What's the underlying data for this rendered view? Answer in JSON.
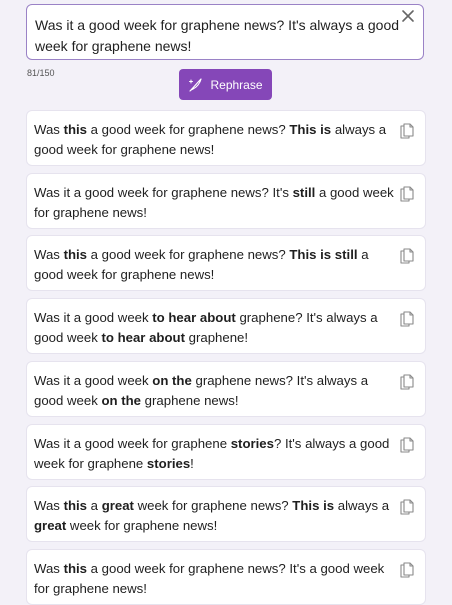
{
  "input": {
    "text": "Was it a good week for graphene news? It's always a good week for graphene news!",
    "char_count": "81/150"
  },
  "toolbar": {
    "rephrase_label": "Rephrase"
  },
  "colors": {
    "accent": "#8547b8",
    "input_border": "#9a82c6",
    "background": "#f3f1f8"
  },
  "icons": {
    "close": "close-icon",
    "rephrase": "quill-sparkle-icon",
    "copy": "copy-icon"
  },
  "results": [
    {
      "segments": [
        {
          "t": "Was ",
          "b": false
        },
        {
          "t": "this",
          "b": true
        },
        {
          "t": " a good week for graphene news? ",
          "b": false
        },
        {
          "t": "This is",
          "b": true
        },
        {
          "t": " always a good week for graphene news!",
          "b": false
        }
      ]
    },
    {
      "segments": [
        {
          "t": "Was it a good week for graphene news? It's ",
          "b": false
        },
        {
          "t": "still",
          "b": true
        },
        {
          "t": " a good week for graphene news!",
          "b": false
        }
      ]
    },
    {
      "segments": [
        {
          "t": "Was ",
          "b": false
        },
        {
          "t": "this",
          "b": true
        },
        {
          "t": " a good week for graphene news? ",
          "b": false
        },
        {
          "t": "This is still",
          "b": true
        },
        {
          "t": " a good week for graphene news!",
          "b": false
        }
      ]
    },
    {
      "segments": [
        {
          "t": "Was it a good week ",
          "b": false
        },
        {
          "t": "to hear about",
          "b": true
        },
        {
          "t": " graphene? It's always a good week ",
          "b": false
        },
        {
          "t": "to hear about",
          "b": true
        },
        {
          "t": " graphene!",
          "b": false
        }
      ]
    },
    {
      "segments": [
        {
          "t": "Was it a good week ",
          "b": false
        },
        {
          "t": "on the",
          "b": true
        },
        {
          "t": " graphene news? It's always a good week ",
          "b": false
        },
        {
          "t": "on the",
          "b": true
        },
        {
          "t": " graphene news!",
          "b": false
        }
      ]
    },
    {
      "segments": [
        {
          "t": "Was it a good week for graphene ",
          "b": false
        },
        {
          "t": "stories",
          "b": true
        },
        {
          "t": "? It's always a good week for graphene ",
          "b": false
        },
        {
          "t": "stories",
          "b": true
        },
        {
          "t": "!",
          "b": false
        }
      ]
    },
    {
      "segments": [
        {
          "t": "Was ",
          "b": false
        },
        {
          "t": "this",
          "b": true
        },
        {
          "t": " a ",
          "b": false
        },
        {
          "t": "great",
          "b": true
        },
        {
          "t": " week for graphene news? ",
          "b": false
        },
        {
          "t": "This is",
          "b": true
        },
        {
          "t": " always a ",
          "b": false
        },
        {
          "t": "great",
          "b": true
        },
        {
          "t": " week for graphene news!",
          "b": false
        }
      ]
    },
    {
      "segments": [
        {
          "t": "Was ",
          "b": false
        },
        {
          "t": "this",
          "b": true
        },
        {
          "t": " a good week for graphene news? It's a good week for graphene news!",
          "b": false
        }
      ]
    }
  ]
}
